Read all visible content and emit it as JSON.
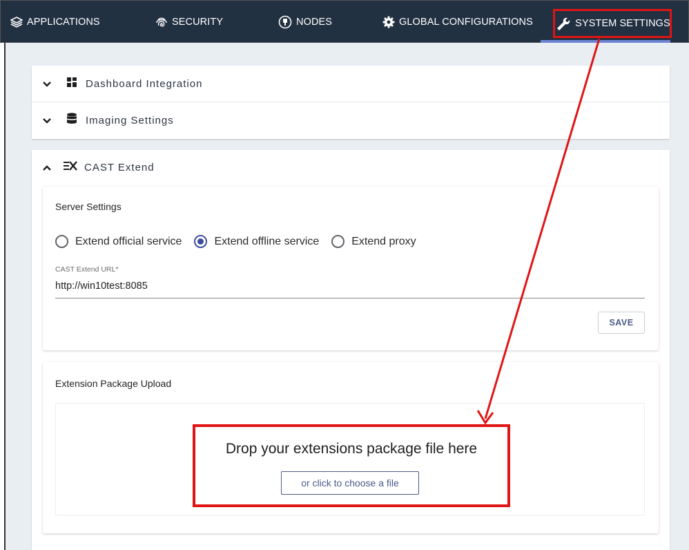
{
  "nav": {
    "items": [
      {
        "label": "APPLICATIONS",
        "icon": "stack-layers-icon"
      },
      {
        "label": "SECURITY",
        "icon": "fingerprint-icon"
      },
      {
        "label": "NODES",
        "icon": "plug-icon"
      },
      {
        "label": "GLOBAL CONFIGURATIONS",
        "icon": "gear-icon"
      },
      {
        "label": "SYSTEM SETTINGS",
        "icon": "wrench-icon",
        "active": true
      }
    ]
  },
  "panels": {
    "dashboard": {
      "label": "Dashboard Integration",
      "icon": "dashboard-icon",
      "expanded": false
    },
    "imaging": {
      "label": "Imaging Settings",
      "icon": "database-icon",
      "expanded": false
    },
    "extend": {
      "label": "CAST Extend",
      "icon": "cast-extend-icon",
      "expanded": true
    }
  },
  "server_settings": {
    "title": "Server Settings",
    "options": [
      {
        "label": "Extend official service",
        "checked": false
      },
      {
        "label": "Extend offline service",
        "checked": true
      },
      {
        "label": "Extend proxy",
        "checked": false
      }
    ],
    "url_label": "CAST Extend URL*",
    "url_value": "http://win10test:8085",
    "save_label": "SAVE"
  },
  "upload": {
    "title": "Extension Package Upload",
    "drop_text": "Drop your extensions package file here",
    "choose_label": "or click to choose a file"
  },
  "colors": {
    "nav_bg": "#223142",
    "accent": "#3e4ca0",
    "highlight": "#e01414",
    "page_bg": "#e9eef3"
  }
}
